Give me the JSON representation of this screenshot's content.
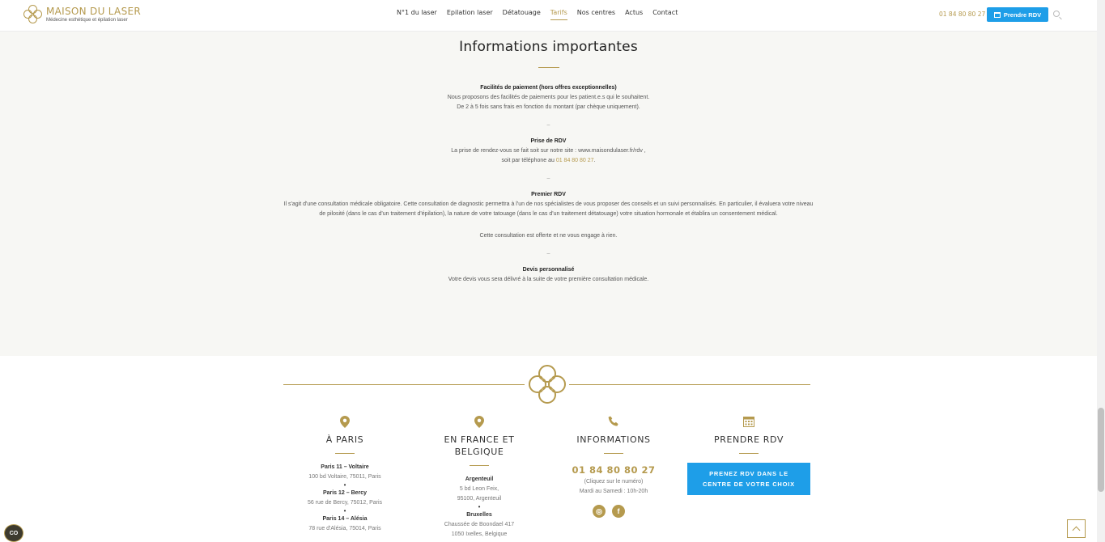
{
  "header": {
    "logo_name": "MAISON DU LASER",
    "logo_tagline": "Médecine esthétique et épilation laser",
    "nav": [
      "N°1 du laser",
      "Epilation laser",
      "Détatouage",
      "Tarifs",
      "Nos centres",
      "Actus",
      "Contact"
    ],
    "active_nav": "Tarifs",
    "phone": "01 84 80 80 27",
    "rdv_label": "Prendre RDV"
  },
  "info": {
    "title": "Informations importantes",
    "blocks": [
      {
        "title": "Facilités de paiement (hors offres exceptionnelles)",
        "lines": [
          "Nous proposons des facilités de paiements pour les patient.e.s qui le souhaitent.",
          "De 2 à 5 fois sans frais en fonction du montant (par chèque uniquement)."
        ]
      },
      {
        "title": "Prise de RDV",
        "lines": [
          "La prise de rendez-vous se fait soit sur notre site : www.maisondulaser.fr/rdv ,"
        ],
        "phone_prefix": "soit par téléphone au ",
        "phone": "01 84 80 80 27",
        "phone_suffix": "."
      },
      {
        "title": "Premier RDV",
        "lines": [
          "Il s'agit d'une consultation médicale obligatoire. Cette consultation de diagnostic permettra à l'un de nos spécialistes de vous proposer des conseils et un suivi personnalisés. En particulier, il évaluera votre niveau de pilosité (dans le cas d'un traitement d'épilation), la nature de votre tatouage (dans le cas d'un traitement détatouage) votre situation hormonale et établira un consentement médical."
        ],
        "extra": "Cette consultation est offerte et ne vous engage à rien."
      },
      {
        "title": "Devis personnalisé",
        "lines": [
          "Votre devis vous sera délivré à la suite de votre première consultation médicale."
        ]
      }
    ],
    "separator": "–"
  },
  "footer": {
    "paris": {
      "title": "À PARIS",
      "centres": [
        {
          "name": "Paris 11 – Voltaire",
          "address": "100 bd Voltaire, 75011, Paris"
        },
        {
          "name": "Paris 12 – Bercy",
          "address": "56 rue de Bercy, 75012, Paris"
        },
        {
          "name": "Paris 14 – Alésia",
          "address": "78 rue d'Alésia, 75014, Paris"
        }
      ]
    },
    "france": {
      "title": "EN FRANCE ET BELGIQUE",
      "centres": [
        {
          "name": "Argenteuil",
          "address_1": "5 bd Leon Feix,",
          "address_2": "95100, Argenteuil"
        },
        {
          "name": "Bruxelles",
          "address_1": "Chaussée de Boondael 417",
          "address_2": "1050 Ixelles, Belgique"
        }
      ]
    },
    "informations": {
      "title": "INFORMATIONS",
      "phone": "01 84 80 80 27",
      "phone_hint": "(Cliquez sur le numéro)",
      "hours": "Mardi au Samedi : 10h-20h",
      "socials": [
        "instagram-icon",
        "facebook-icon"
      ]
    },
    "rdv": {
      "title": "PRENDRE RDV",
      "cta": "PRENEZ RDV DANS LE CENTRE DE VOTRE CHOIX"
    }
  },
  "cookie_label": "CO",
  "colors": {
    "gold": "#b59a4e",
    "blue": "#1e9ee8",
    "background": "#f7f7f4"
  }
}
